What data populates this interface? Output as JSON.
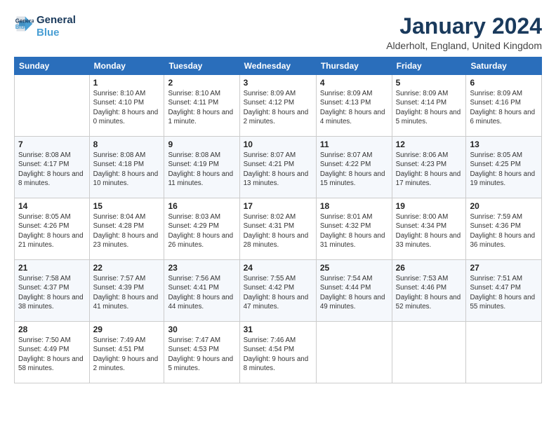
{
  "header": {
    "logo": {
      "line1": "General",
      "line2": "Blue",
      "icon": "▶"
    },
    "title": "January 2024",
    "location": "Alderholt, England, United Kingdom"
  },
  "calendar": {
    "days": [
      "Sunday",
      "Monday",
      "Tuesday",
      "Wednesday",
      "Thursday",
      "Friday",
      "Saturday"
    ],
    "weeks": [
      [
        {
          "date": "",
          "sunrise": "",
          "sunset": "",
          "daylight": ""
        },
        {
          "date": "1",
          "sunrise": "Sunrise: 8:10 AM",
          "sunset": "Sunset: 4:10 PM",
          "daylight": "Daylight: 8 hours and 0 minutes."
        },
        {
          "date": "2",
          "sunrise": "Sunrise: 8:10 AM",
          "sunset": "Sunset: 4:11 PM",
          "daylight": "Daylight: 8 hours and 1 minute."
        },
        {
          "date": "3",
          "sunrise": "Sunrise: 8:09 AM",
          "sunset": "Sunset: 4:12 PM",
          "daylight": "Daylight: 8 hours and 2 minutes."
        },
        {
          "date": "4",
          "sunrise": "Sunrise: 8:09 AM",
          "sunset": "Sunset: 4:13 PM",
          "daylight": "Daylight: 8 hours and 4 minutes."
        },
        {
          "date": "5",
          "sunrise": "Sunrise: 8:09 AM",
          "sunset": "Sunset: 4:14 PM",
          "daylight": "Daylight: 8 hours and 5 minutes."
        },
        {
          "date": "6",
          "sunrise": "Sunrise: 8:09 AM",
          "sunset": "Sunset: 4:16 PM",
          "daylight": "Daylight: 8 hours and 6 minutes."
        }
      ],
      [
        {
          "date": "7",
          "sunrise": "Sunrise: 8:08 AM",
          "sunset": "Sunset: 4:17 PM",
          "daylight": "Daylight: 8 hours and 8 minutes."
        },
        {
          "date": "8",
          "sunrise": "Sunrise: 8:08 AM",
          "sunset": "Sunset: 4:18 PM",
          "daylight": "Daylight: 8 hours and 10 minutes."
        },
        {
          "date": "9",
          "sunrise": "Sunrise: 8:08 AM",
          "sunset": "Sunset: 4:19 PM",
          "daylight": "Daylight: 8 hours and 11 minutes."
        },
        {
          "date": "10",
          "sunrise": "Sunrise: 8:07 AM",
          "sunset": "Sunset: 4:21 PM",
          "daylight": "Daylight: 8 hours and 13 minutes."
        },
        {
          "date": "11",
          "sunrise": "Sunrise: 8:07 AM",
          "sunset": "Sunset: 4:22 PM",
          "daylight": "Daylight: 8 hours and 15 minutes."
        },
        {
          "date": "12",
          "sunrise": "Sunrise: 8:06 AM",
          "sunset": "Sunset: 4:23 PM",
          "daylight": "Daylight: 8 hours and 17 minutes."
        },
        {
          "date": "13",
          "sunrise": "Sunrise: 8:05 AM",
          "sunset": "Sunset: 4:25 PM",
          "daylight": "Daylight: 8 hours and 19 minutes."
        }
      ],
      [
        {
          "date": "14",
          "sunrise": "Sunrise: 8:05 AM",
          "sunset": "Sunset: 4:26 PM",
          "daylight": "Daylight: 8 hours and 21 minutes."
        },
        {
          "date": "15",
          "sunrise": "Sunrise: 8:04 AM",
          "sunset": "Sunset: 4:28 PM",
          "daylight": "Daylight: 8 hours and 23 minutes."
        },
        {
          "date": "16",
          "sunrise": "Sunrise: 8:03 AM",
          "sunset": "Sunset: 4:29 PM",
          "daylight": "Daylight: 8 hours and 26 minutes."
        },
        {
          "date": "17",
          "sunrise": "Sunrise: 8:02 AM",
          "sunset": "Sunset: 4:31 PM",
          "daylight": "Daylight: 8 hours and 28 minutes."
        },
        {
          "date": "18",
          "sunrise": "Sunrise: 8:01 AM",
          "sunset": "Sunset: 4:32 PM",
          "daylight": "Daylight: 8 hours and 31 minutes."
        },
        {
          "date": "19",
          "sunrise": "Sunrise: 8:00 AM",
          "sunset": "Sunset: 4:34 PM",
          "daylight": "Daylight: 8 hours and 33 minutes."
        },
        {
          "date": "20",
          "sunrise": "Sunrise: 7:59 AM",
          "sunset": "Sunset: 4:36 PM",
          "daylight": "Daylight: 8 hours and 36 minutes."
        }
      ],
      [
        {
          "date": "21",
          "sunrise": "Sunrise: 7:58 AM",
          "sunset": "Sunset: 4:37 PM",
          "daylight": "Daylight: 8 hours and 38 minutes."
        },
        {
          "date": "22",
          "sunrise": "Sunrise: 7:57 AM",
          "sunset": "Sunset: 4:39 PM",
          "daylight": "Daylight: 8 hours and 41 minutes."
        },
        {
          "date": "23",
          "sunrise": "Sunrise: 7:56 AM",
          "sunset": "Sunset: 4:41 PM",
          "daylight": "Daylight: 8 hours and 44 minutes."
        },
        {
          "date": "24",
          "sunrise": "Sunrise: 7:55 AM",
          "sunset": "Sunset: 4:42 PM",
          "daylight": "Daylight: 8 hours and 47 minutes."
        },
        {
          "date": "25",
          "sunrise": "Sunrise: 7:54 AM",
          "sunset": "Sunset: 4:44 PM",
          "daylight": "Daylight: 8 hours and 49 minutes."
        },
        {
          "date": "26",
          "sunrise": "Sunrise: 7:53 AM",
          "sunset": "Sunset: 4:46 PM",
          "daylight": "Daylight: 8 hours and 52 minutes."
        },
        {
          "date": "27",
          "sunrise": "Sunrise: 7:51 AM",
          "sunset": "Sunset: 4:47 PM",
          "daylight": "Daylight: 8 hours and 55 minutes."
        }
      ],
      [
        {
          "date": "28",
          "sunrise": "Sunrise: 7:50 AM",
          "sunset": "Sunset: 4:49 PM",
          "daylight": "Daylight: 8 hours and 58 minutes."
        },
        {
          "date": "29",
          "sunrise": "Sunrise: 7:49 AM",
          "sunset": "Sunset: 4:51 PM",
          "daylight": "Daylight: 9 hours and 2 minutes."
        },
        {
          "date": "30",
          "sunrise": "Sunrise: 7:47 AM",
          "sunset": "Sunset: 4:53 PM",
          "daylight": "Daylight: 9 hours and 5 minutes."
        },
        {
          "date": "31",
          "sunrise": "Sunrise: 7:46 AM",
          "sunset": "Sunset: 4:54 PM",
          "daylight": "Daylight: 9 hours and 8 minutes."
        },
        {
          "date": "",
          "sunrise": "",
          "sunset": "",
          "daylight": ""
        },
        {
          "date": "",
          "sunrise": "",
          "sunset": "",
          "daylight": ""
        },
        {
          "date": "",
          "sunrise": "",
          "sunset": "",
          "daylight": ""
        }
      ]
    ]
  }
}
